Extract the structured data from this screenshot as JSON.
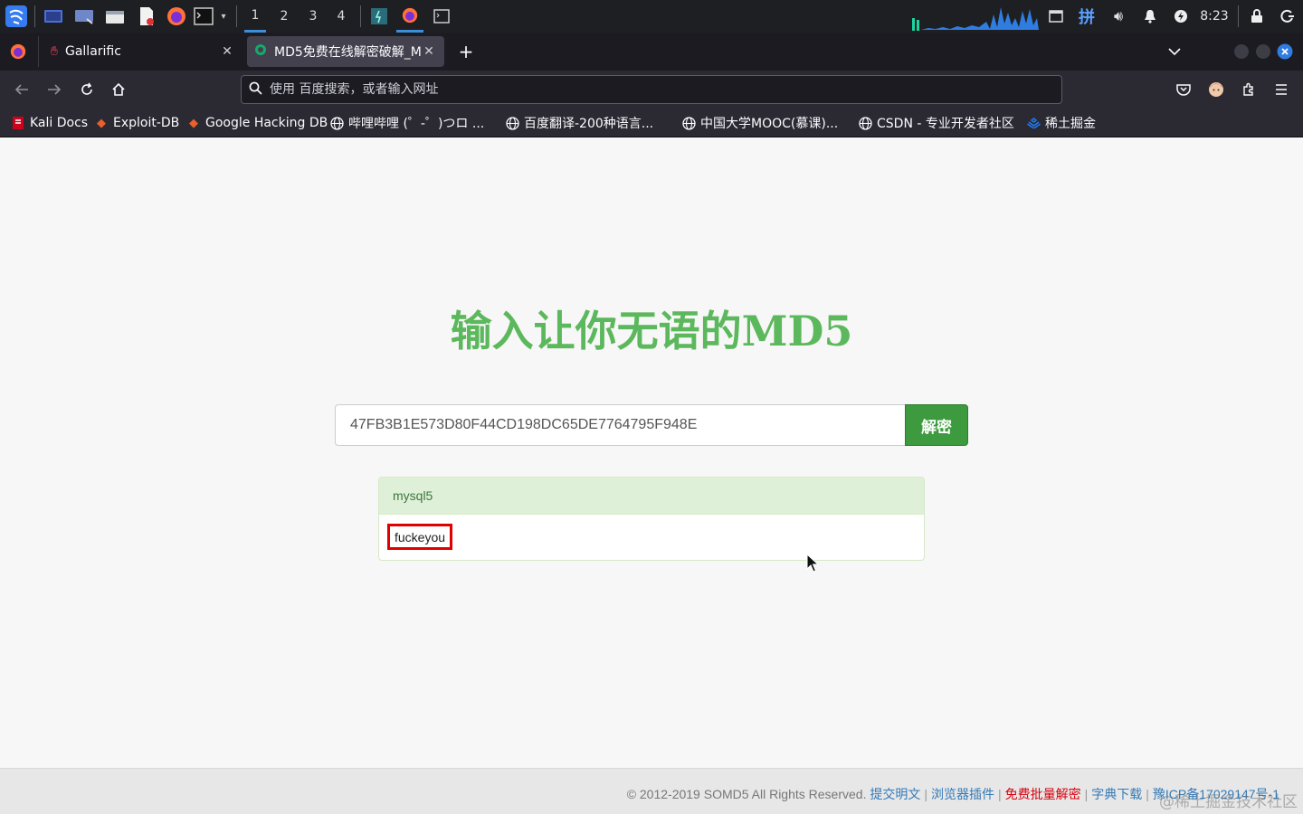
{
  "taskbar": {
    "workspaces": [
      "1",
      "2",
      "3",
      "4"
    ],
    "active_workspace": "1",
    "ime_label": "拼",
    "clock": "8:23"
  },
  "browser": {
    "tabs": [
      {
        "title": "Gallarific",
        "active": false
      },
      {
        "title": "MD5免费在线解密破解_M",
        "active": true
      }
    ],
    "new_tab_label": "+",
    "urlbar_placeholder": "使用 百度搜索，或者输入网址",
    "bookmarks": [
      "Kali Docs",
      "Exploit-DB",
      "Google Hacking DB",
      "哔哩哔哩 (゜-゜)つロ ...",
      "百度翻译-200种语言...",
      "中国大学MOOC(慕课)...",
      "CSDN - 专业开发者社区",
      "稀土掘金"
    ]
  },
  "page": {
    "headline": "输入让你无语的MD5",
    "hash_value": "47FB3B1E573D80F44CD198DC65DE7764795F948E",
    "decrypt_button": "解密",
    "result_type": "mysql5",
    "result_value": "fuckeyou"
  },
  "footer": {
    "copyright": "© 2012-2019 SOMD5 All Rights Reserved.",
    "links": [
      "提交明文",
      "浏览器插件",
      "免费批量解密",
      "字典下载",
      "豫ICP备17029147号-1"
    ],
    "watermark": "@稀土掘金技术社区"
  },
  "colors": {
    "headline_green": "#5cb85c",
    "button_green": "#3e9a3e",
    "result_header_bg": "#dff0d8",
    "highlight_red": "#e00000",
    "link_blue": "#337ab7",
    "link_red": "#d9000d"
  }
}
